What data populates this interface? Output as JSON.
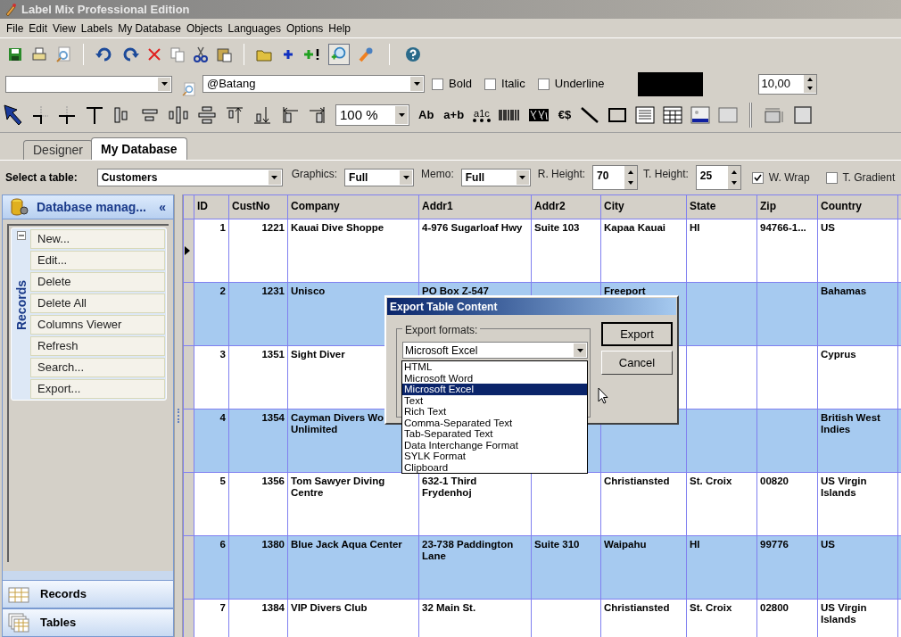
{
  "window": {
    "title": "Label Mix Professional Edition"
  },
  "menu": [
    "File",
    "Edit",
    "View",
    "Labels",
    "My Database",
    "Objects",
    "Languages",
    "Options",
    "Help"
  ],
  "format_bar": {
    "font": "@Batang",
    "styles": [
      {
        "label": "Bold",
        "checked": false
      },
      {
        "label": "Italic",
        "checked": false
      },
      {
        "label": "Underline",
        "checked": false
      }
    ],
    "color": "#000000",
    "size": "10,00"
  },
  "draw_toolbar": {
    "zoom": "100 %",
    "text_tools": [
      "Ab",
      "a+b",
      "a1c",
      "€$"
    ]
  },
  "tabs": [
    {
      "label": "Designer",
      "selected": false
    },
    {
      "label": "My Database",
      "selected": true
    }
  ],
  "table_filter": {
    "label": "Select a table:",
    "table": "Customers",
    "fields": [
      {
        "label": "Graphics:",
        "value": "Full",
        "kind": "combo"
      },
      {
        "label": "Memo:",
        "value": "Full",
        "kind": "combo"
      },
      {
        "label": "R. Height:",
        "value": "70",
        "kind": "spin"
      },
      {
        "label": "T. Height:",
        "value": "25",
        "kind": "spin"
      }
    ],
    "options": [
      {
        "label": "W. Wrap",
        "checked": true
      },
      {
        "label": "T. Gradient",
        "checked": false
      }
    ]
  },
  "sidebar": {
    "title": "Database manag...",
    "collapse": "«",
    "group": {
      "title": "Records",
      "expanded": true,
      "items": [
        "New...",
        "Edit...",
        "Delete",
        "Delete All",
        "Columns Viewer",
        "Refresh",
        "Search...",
        "Export..."
      ]
    },
    "nav": [
      {
        "label": "Records",
        "kind": "record"
      },
      {
        "label": "Tables",
        "kind": "tables"
      }
    ]
  },
  "grid": {
    "columns": [
      "ID",
      "CustNo",
      "Company",
      "Addr1",
      "Addr2",
      "City",
      "State",
      "Zip",
      "Country"
    ],
    "rows": [
      {
        "current": true,
        "cells": [
          "1",
          "1221",
          "Kauai Dive Shoppe",
          "4-976 Sugarloaf Hwy",
          "Suite 103",
          "Kapaa Kauai",
          "HI",
          "94766-1...",
          "US"
        ]
      },
      {
        "current": false,
        "cells": [
          "2",
          "1231",
          "Unisco",
          "PO Box Z-547",
          "",
          "Freeport",
          "",
          "",
          "Bahamas"
        ]
      },
      {
        "current": false,
        "cells": [
          "3",
          "1351",
          "Sight Diver",
          "",
          "",
          "",
          "",
          "",
          "Cyprus"
        ]
      },
      {
        "current": false,
        "cells": [
          "4",
          "1354",
          "Cayman Divers Wo Unlimited",
          "",
          "",
          "",
          "",
          "",
          "British West Indies"
        ]
      },
      {
        "current": false,
        "cells": [
          "5",
          "1356",
          "Tom Sawyer Diving Centre",
          "632-1 Third Frydenhoj",
          "",
          "Christiansted",
          "St. Croix",
          "00820",
          "US Virgin Islands"
        ]
      },
      {
        "current": false,
        "cells": [
          "6",
          "1380",
          "Blue Jack Aqua Center",
          "23-738 Paddington Lane",
          "Suite 310",
          "Waipahu",
          "HI",
          "99776",
          "US"
        ]
      },
      {
        "current": false,
        "cells": [
          "7",
          "1384",
          "VIP Divers Club",
          "32 Main St.",
          "",
          "Christiansted",
          "St. Croix",
          "02800",
          "US Virgin Islands"
        ]
      }
    ]
  },
  "dialog": {
    "title": "Export Table Content",
    "group_label": "Export formats:",
    "value": "Microsoft Excel",
    "options": [
      {
        "label": "HTML",
        "selected": false
      },
      {
        "label": "Microsoft Word",
        "selected": false
      },
      {
        "label": "Microsoft Excel",
        "selected": true
      },
      {
        "label": "Text",
        "selected": false
      },
      {
        "label": "Rich Text",
        "selected": false
      },
      {
        "label": "Comma-Separated Text",
        "selected": false
      },
      {
        "label": "Tab-Separated Text",
        "selected": false
      },
      {
        "label": "Data Interchange Format",
        "selected": false
      },
      {
        "label": "SYLK Format",
        "selected": false
      },
      {
        "label": "Clipboard",
        "selected": false
      }
    ],
    "buttons": [
      {
        "label": "Export",
        "default": true
      },
      {
        "label": "Cancel",
        "default": false
      }
    ]
  }
}
